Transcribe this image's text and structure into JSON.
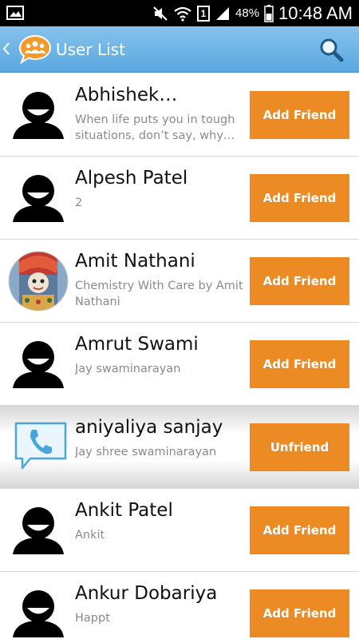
{
  "status_bar": {
    "battery_percent": "48%",
    "time": "10:48 AM",
    "sim_badge": "1"
  },
  "action_bar": {
    "title": "User List",
    "logo_icon": "group-chat-logo-icon",
    "search_icon": "search-icon"
  },
  "colors": {
    "action_bar": "#5aa8e0",
    "button": "#ec8a23"
  },
  "users": [
    {
      "name": "Abhishek…",
      "subtitle": "When life puts you in tough situations,  don’t say, why…",
      "action": "Add Friend",
      "avatar": "default-user-icon"
    },
    {
      "name": "Alpesh  Patel",
      "subtitle": "2",
      "action": "Add Friend",
      "avatar": "default-user-icon"
    },
    {
      "name": "Amit Nathani",
      "subtitle": "Chemistry With Care by Amit Nathani",
      "action": "Add Friend",
      "avatar": "photo-avatar"
    },
    {
      "name": "Amrut Swami",
      "subtitle": "Jay swaminarayan",
      "action": "Add Friend",
      "avatar": "default-user-icon"
    },
    {
      "name": "aniyaliya    sanjay",
      "subtitle": "Jay shree swaminarayan",
      "action": "Unfriend",
      "avatar": "phone-chat-icon"
    },
    {
      "name": "Ankit Patel",
      "subtitle": "Ankit",
      "action": "Add Friend",
      "avatar": "default-user-icon"
    },
    {
      "name": "Ankur Dobariya",
      "subtitle": "Happt",
      "action": "Add Friend",
      "avatar": "default-user-icon"
    }
  ]
}
